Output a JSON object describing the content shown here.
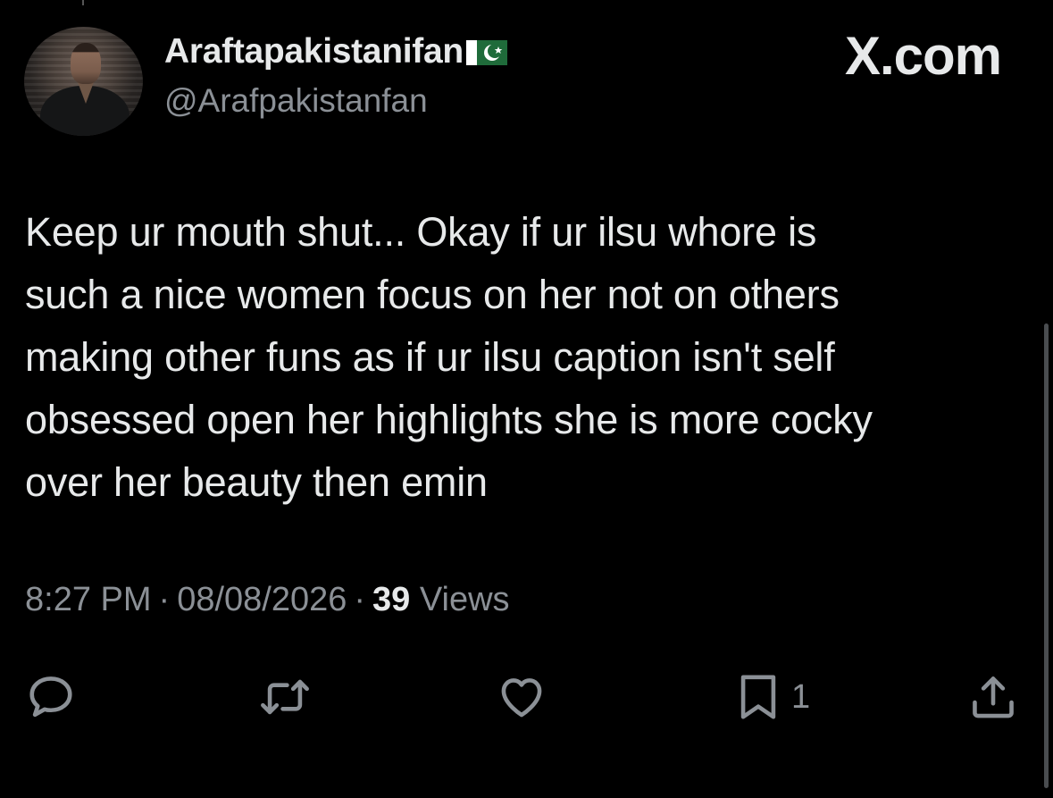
{
  "brand": "X.com",
  "author": {
    "display_name": "Araftapakistanifan",
    "flag": "pakistan-flag",
    "handle": "@Arafpakistanfan"
  },
  "tweet": {
    "lines": [
      "Keep ur mouth shut... Okay if ur ilsu whore is",
      "such a nice women focus on her not on others",
      "making other funs as if ur ilsu caption isn't self",
      "obsessed open her highlights she is more cocky",
      "over her beauty then emin"
    ]
  },
  "meta": {
    "time": "8:27 PM",
    "separator": "·",
    "date": "08/08/2026",
    "views_count": "39",
    "views_label": "Views"
  },
  "actions": {
    "reply": {
      "icon": "reply-icon"
    },
    "retweet": {
      "icon": "retweet-icon"
    },
    "like": {
      "icon": "heart-icon"
    },
    "bookmark": {
      "icon": "bookmark-icon",
      "count": "1"
    },
    "share": {
      "icon": "share-icon"
    }
  },
  "colors": {
    "background": "#000000",
    "text": "#e7e9ea",
    "secondary": "#8b9096"
  }
}
